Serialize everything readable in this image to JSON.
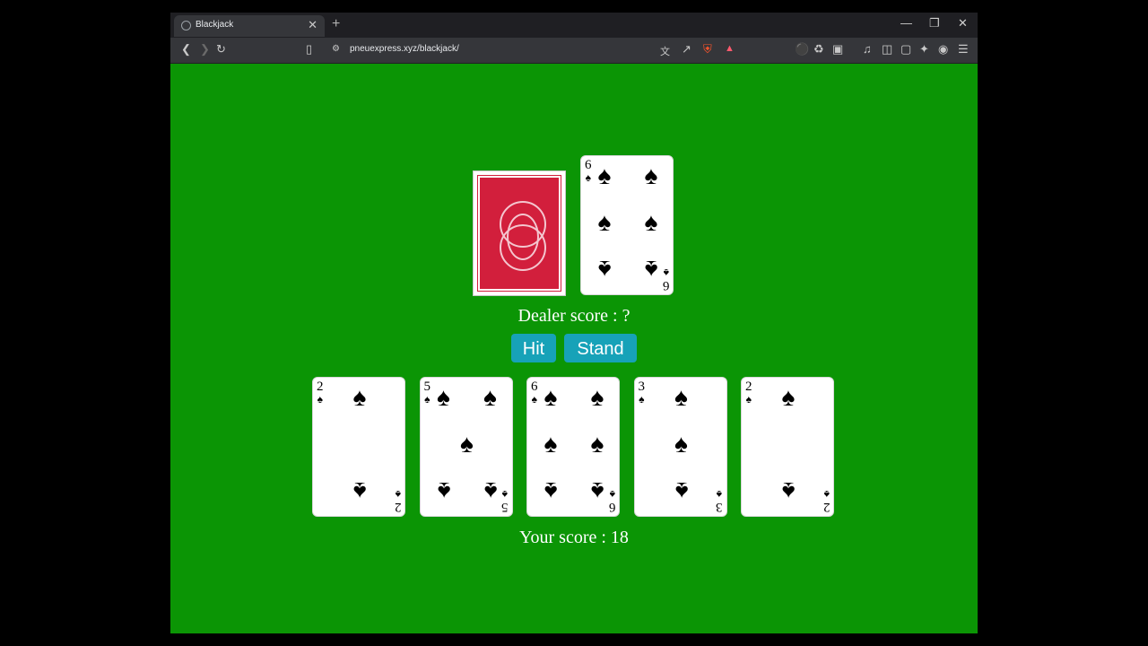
{
  "browser": {
    "tab_title": "Blackjack",
    "tab_close": "✕",
    "new_tab": "+",
    "url": "pneuexpress.xyz/blackjack/",
    "window_controls": {
      "minimize": "—",
      "restore": "❐",
      "close": "✕"
    }
  },
  "game": {
    "dealer": {
      "score_label": "Dealer score : ?",
      "cards": [
        {
          "face": "down"
        },
        {
          "face": "up",
          "rank": "6",
          "suit": "spades"
        }
      ]
    },
    "buttons": {
      "hit": "Hit",
      "stand": "Stand"
    },
    "player": {
      "score_label": "Your score : 18",
      "cards": [
        {
          "rank": "2",
          "suit": "spades"
        },
        {
          "rank": "5",
          "suit": "spades"
        },
        {
          "rank": "6",
          "suit": "spades"
        },
        {
          "rank": "3",
          "suit": "spades"
        },
        {
          "rank": "2",
          "suit": "spades"
        }
      ]
    }
  },
  "colors": {
    "table": "#0b9505",
    "button": "#17a2b8",
    "card_back": "#d21f3c"
  },
  "suit_symbol": "♠"
}
